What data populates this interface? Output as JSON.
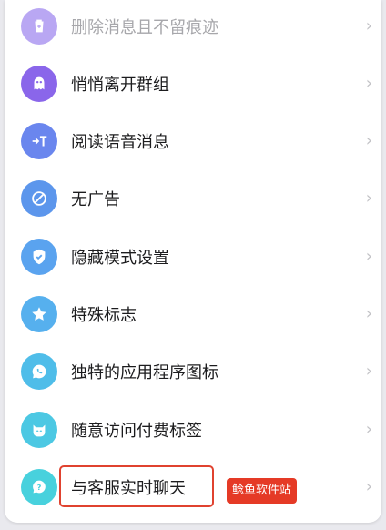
{
  "items": [
    {
      "label": "删除消息且不留痕迹",
      "icon": "trash-icon",
      "color": "#b9a7f3",
      "faded": true
    },
    {
      "label": "悄悄离开群组",
      "icon": "ghost-icon",
      "color": "#8a66ea"
    },
    {
      "label": "阅读语音消息",
      "icon": "voice-to-text-icon",
      "color": "#6a86ee"
    },
    {
      "label": "无广告",
      "icon": "no-ads-icon",
      "color": "#5c96ec"
    },
    {
      "label": "隐藏模式设置",
      "icon": "shield-icon",
      "color": "#5aa3ef"
    },
    {
      "label": "特殊标志",
      "icon": "star-icon",
      "color": "#56b0ee"
    },
    {
      "label": "独特的应用程序图标",
      "icon": "phone-bubble-icon",
      "color": "#4fbde9"
    },
    {
      "label": "随意访问付费标签",
      "icon": "cat-icon",
      "color": "#4cc8e3"
    },
    {
      "label": "与客服实时聊天",
      "icon": "support-chat-icon",
      "color": "#48d1dd"
    }
  ],
  "chevron": "›",
  "badge": "鲶鱼软件站"
}
